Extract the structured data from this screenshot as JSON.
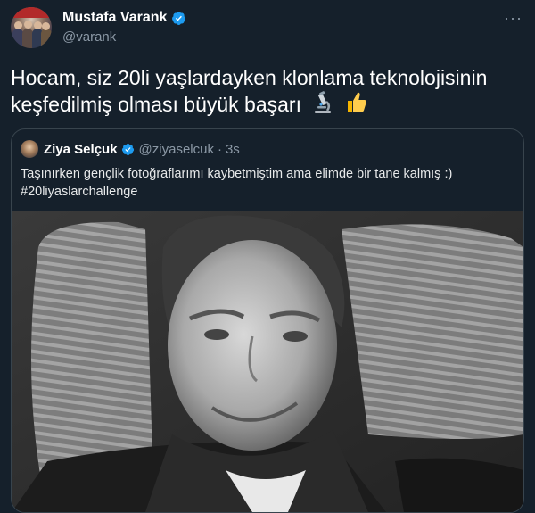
{
  "tweet": {
    "display_name": "Mustafa Varank",
    "handle": "@varank",
    "more_icon": "more-icon",
    "text": "Hocam, siz 20li yaşlardayken klonlama teknolojisinin keşfedilmiş olması büyük başarı"
  },
  "quote": {
    "display_name": "Ziya Selçuk",
    "handle": "@ziyaselcuk",
    "separator": "·",
    "time": "3s",
    "text": "Taşınırken gençlik fotoğraflarımı kaybetmiştim ama elimde bir tane kalmış :)",
    "hashtag": "#20liyaslarchallenge"
  },
  "colors": {
    "background": "#15202b",
    "verified": "#1d9bf0",
    "secondary_text": "#8b98a5",
    "border": "#38444d"
  }
}
